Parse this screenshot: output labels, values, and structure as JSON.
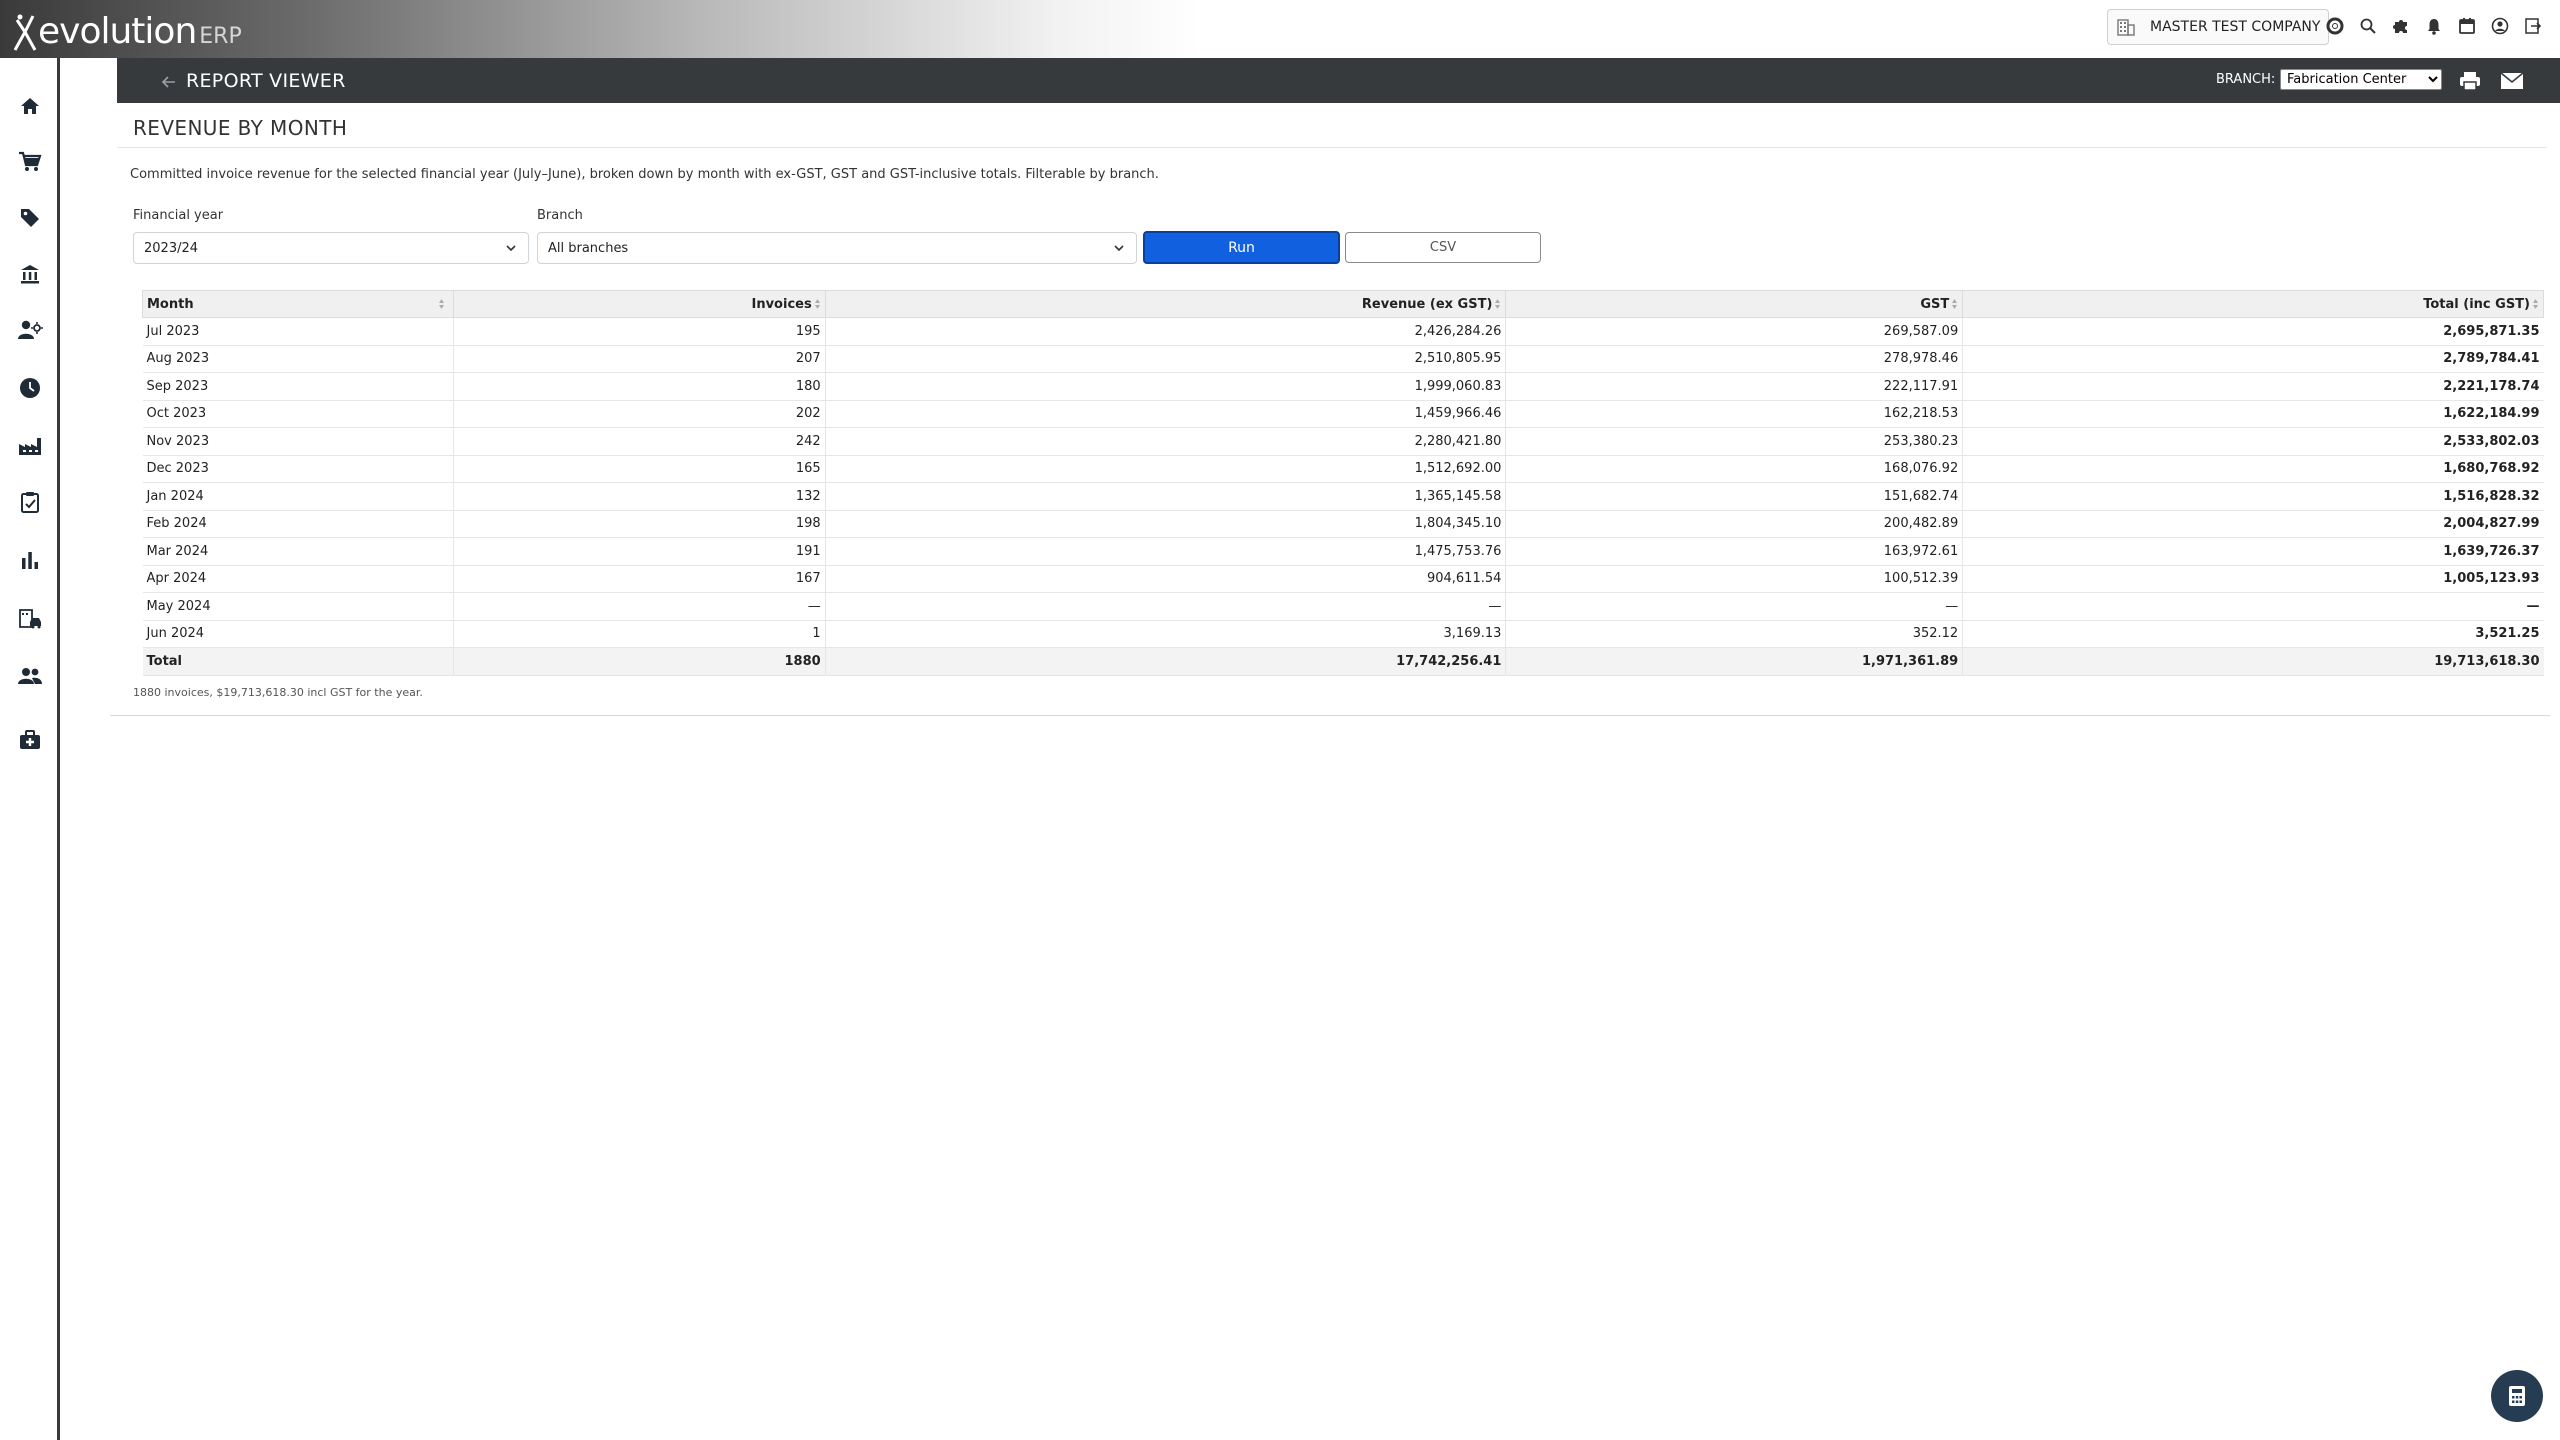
{
  "app": {
    "logo_word": "evolution",
    "logo_suffix": "ERP",
    "company": "MASTER TEST COMPANY"
  },
  "header": {
    "title": "REPORT VIEWER",
    "branch_label": "BRANCH:",
    "branch_selected": "Fabrication Center"
  },
  "report": {
    "title": "REVENUE BY MONTH",
    "description": "Committed invoice revenue for the selected financial year (July–June), broken down by month with ex-GST, GST and GST-inclusive totals. Filterable by branch.",
    "filters": {
      "fy_label": "Financial year",
      "fy_value": "2023/24",
      "branch_label": "Branch",
      "branch_value": "All branches"
    },
    "run_label": "Run",
    "csv_label": "CSV",
    "columns": [
      "Month",
      "Invoices",
      "Revenue (ex GST)",
      "GST",
      "Total (inc GST)"
    ],
    "rows": [
      [
        "Jul 2023",
        "195",
        "2,426,284.26",
        "269,587.09",
        "2,695,871.35"
      ],
      [
        "Aug 2023",
        "207",
        "2,510,805.95",
        "278,978.46",
        "2,789,784.41"
      ],
      [
        "Sep 2023",
        "180",
        "1,999,060.83",
        "222,117.91",
        "2,221,178.74"
      ],
      [
        "Oct 2023",
        "202",
        "1,459,966.46",
        "162,218.53",
        "1,622,184.99"
      ],
      [
        "Nov 2023",
        "242",
        "2,280,421.80",
        "253,380.23",
        "2,533,802.03"
      ],
      [
        "Dec 2023",
        "165",
        "1,512,692.00",
        "168,076.92",
        "1,680,768.92"
      ],
      [
        "Jan 2024",
        "132",
        "1,365,145.58",
        "151,682.74",
        "1,516,828.32"
      ],
      [
        "Feb 2024",
        "198",
        "1,804,345.10",
        "200,482.89",
        "2,004,827.99"
      ],
      [
        "Mar 2024",
        "191",
        "1,475,753.76",
        "163,972.61",
        "1,639,726.37"
      ],
      [
        "Apr 2024",
        "167",
        "904,611.54",
        "100,512.39",
        "1,005,123.93"
      ],
      [
        "May 2024",
        "—",
        "—",
        "—",
        "—"
      ],
      [
        "Jun 2024",
        "1",
        "3,169.13",
        "352.12",
        "3,521.25"
      ]
    ],
    "total": [
      "Total",
      "1880",
      "17,742,256.41",
      "1,971,361.89",
      "19,713,618.30"
    ],
    "footnote": "1880 invoices, $19,713,618.30 incl GST for the year."
  },
  "colors": {
    "header_bg": "#373a3d",
    "run_button": "#1160e0",
    "calc_fab": "#263c52"
  },
  "icons": {
    "sidebar": [
      "home-icon",
      "cart-icon",
      "tag-icon",
      "bank-icon",
      "user-settings-icon",
      "clock-icon",
      "factory-icon",
      "clipboard-check-icon",
      "bar-chart-icon",
      "garage-icon",
      "people-icon",
      "medical-case-icon"
    ],
    "topbar": [
      "support-icon",
      "search-icon",
      "puzzle-icon",
      "bell-icon",
      "calendar-icon",
      "account-icon",
      "logout-icon"
    ]
  }
}
